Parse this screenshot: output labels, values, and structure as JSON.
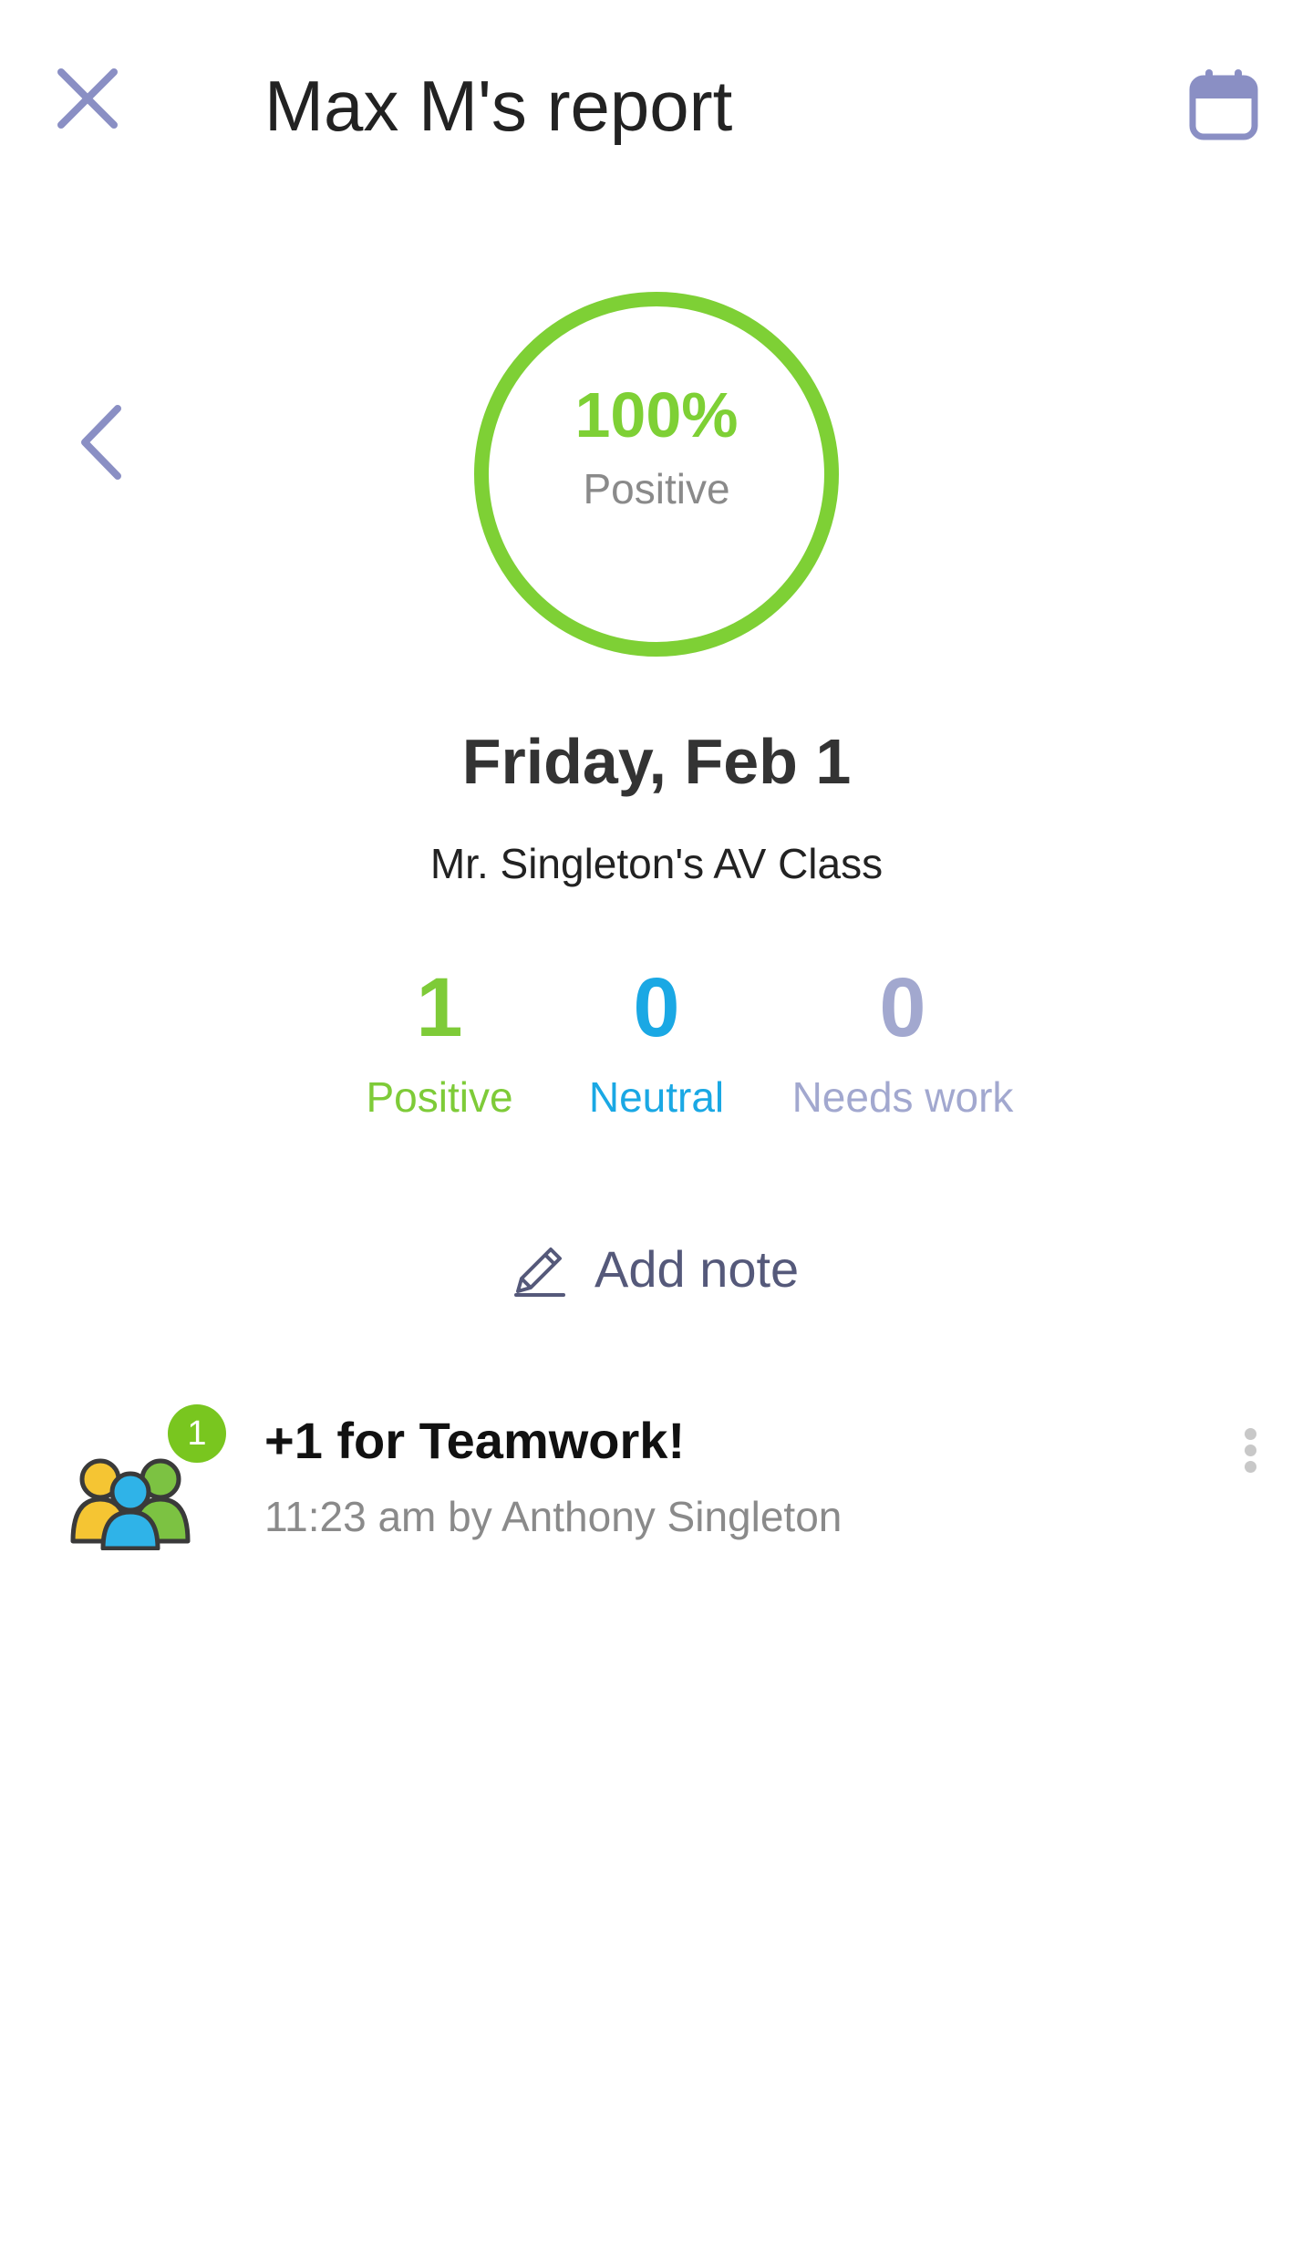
{
  "header": {
    "title": "Max M's report",
    "close_icon": "close-icon",
    "calendar_icon": "calendar-icon"
  },
  "navigation": {
    "previous_icon": "chevron-left-icon"
  },
  "summary": {
    "percent": "100%",
    "percent_label": "Positive",
    "positive_fraction": 1.0,
    "ring_color": "#7ed035"
  },
  "report": {
    "date": "Friday, Feb 1",
    "class_name": "Mr. Singleton's AV Class"
  },
  "stats": {
    "positive": {
      "value": "1",
      "label": "Positive",
      "color": "#7ecb38"
    },
    "neutral": {
      "value": "0",
      "label": "Neutral",
      "color": "#1aa8e4"
    },
    "needs_work": {
      "value": "0",
      "label": "Needs work",
      "color": "#a2a8cf"
    }
  },
  "add_note": {
    "label": "Add note",
    "icon": "pencil-icon"
  },
  "feed": [
    {
      "badge": "1",
      "icon": "teamwork-icon",
      "title": "+1 for Teamwork!",
      "meta": "11:23 am by Anthony Singleton",
      "menu_icon": "more-vertical-icon"
    }
  ]
}
